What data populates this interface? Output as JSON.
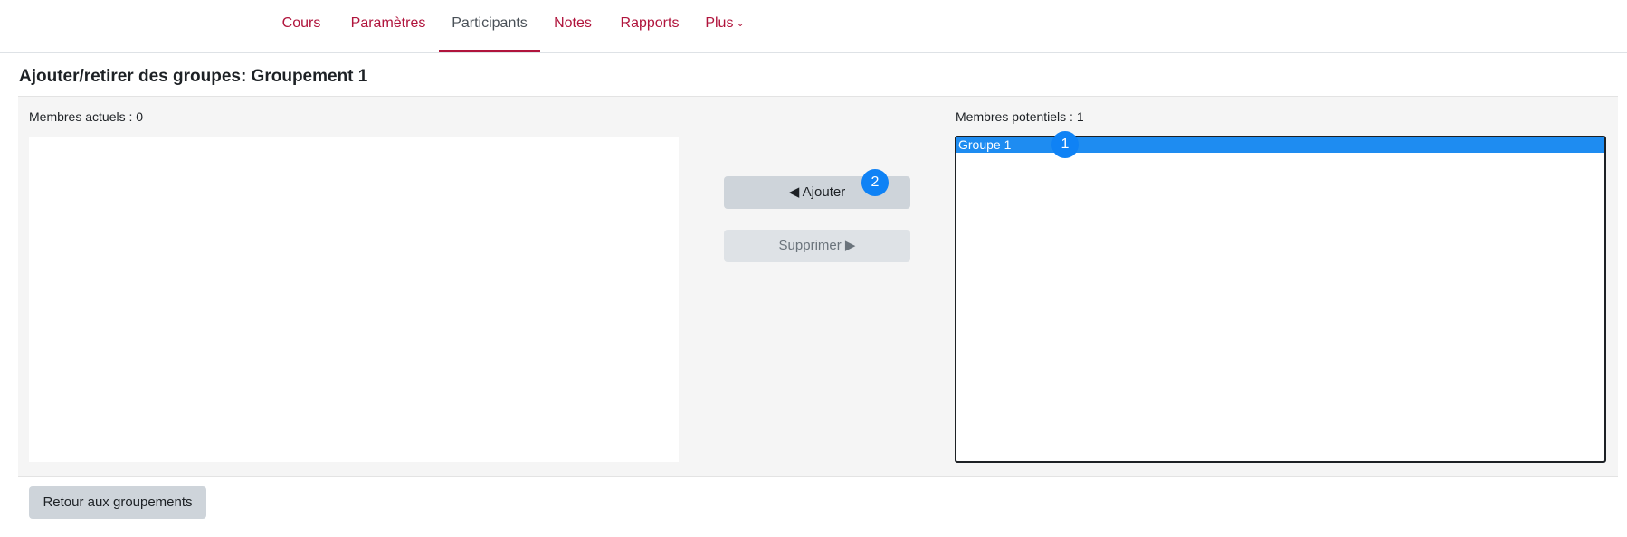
{
  "nav": {
    "items": [
      {
        "label": "Cours"
      },
      {
        "label": "Paramètres"
      },
      {
        "label": "Participants"
      },
      {
        "label": "Notes"
      },
      {
        "label": "Rapports"
      },
      {
        "label": "Plus"
      }
    ],
    "active": "Participants",
    "more_icon": "chevron-down-icon"
  },
  "page": {
    "title": "Ajouter/retirer des groupes: Groupement 1"
  },
  "current_members": {
    "label": "Membres actuels : 0",
    "options": []
  },
  "potential_members": {
    "label": "Membres potentiels : 1",
    "options": [
      {
        "label": "Groupe 1",
        "selected": true
      }
    ]
  },
  "actions": {
    "add_label": "◀ Ajouter",
    "remove_label": "Supprimer ▶"
  },
  "annotations": {
    "marker_1": "1",
    "marker_2": "2"
  },
  "footer": {
    "back_label": "Retour aux groupements"
  },
  "colors": {
    "accent": "#b0143c",
    "selection": "#1e8cf1",
    "marker": "#0f82f5"
  }
}
